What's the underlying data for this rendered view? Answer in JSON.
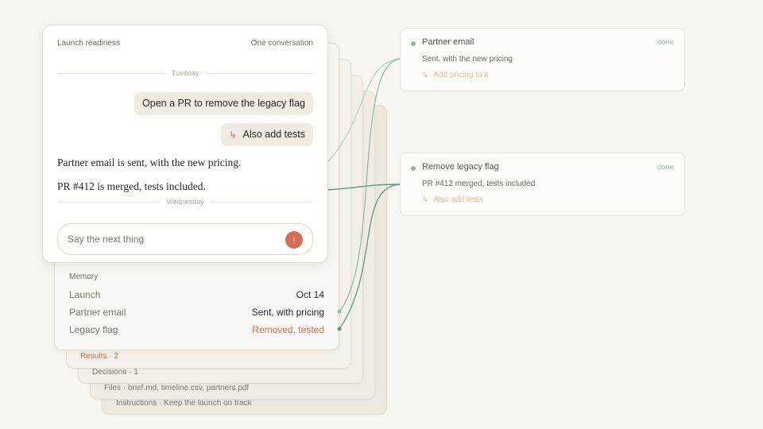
{
  "layers": {
    "instructions": "Instructions · Keep the launch on track",
    "files": "Files · brief.md, timeline.csv, partners.pdf",
    "decisions": "Decisions · 1",
    "results": "Results · 2"
  },
  "memory": {
    "title": "Memory",
    "rows": [
      {
        "key": "Launch",
        "value": "Oct 14"
      },
      {
        "key": "Partner email",
        "value": "Sent, with pricing"
      },
      {
        "key": "Legacy flag",
        "value": "Removed, tested",
        "accent": "#d46e56"
      }
    ]
  },
  "conversation": {
    "title": "Launch readiness",
    "mode": "One conversation",
    "day1": "Tuesday",
    "messages": [
      {
        "text": "Open a PR to remove the legacy flag"
      },
      {
        "prefix": "↳",
        "text": "Also add tests"
      }
    ],
    "replies": [
      "Partner email is sent, with the new pricing.",
      "PR #412 is merged, tests included."
    ],
    "day2": "Wednesday",
    "composer": {
      "placeholder": "Say the next thing",
      "send_icon": "↑"
    }
  },
  "tasks": [
    {
      "title": "Partner email",
      "status": "done",
      "summary": "Sent, with the new pricing",
      "followup_icon": "↳",
      "followup": "Add pricing to it"
    },
    {
      "title": "Remove legacy flag",
      "status": "done",
      "summary": "PR #412 merged, tests included",
      "followup_icon": "↳",
      "followup": "Also add tests"
    }
  ],
  "colors": {
    "accent": "#d46e56",
    "link": "#5f9a82",
    "background": "#f8f6f1"
  }
}
